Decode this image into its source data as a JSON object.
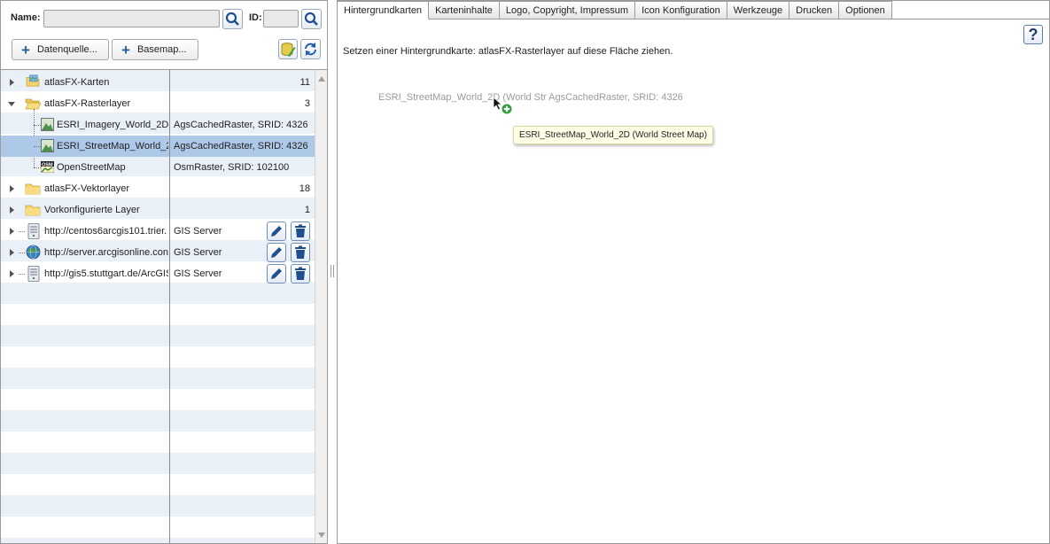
{
  "search": {
    "name_label": "Name:",
    "name_value": "",
    "id_label": "ID:",
    "id_value": ""
  },
  "toolbar": {
    "datasource_label": "Datenquelle...",
    "basemap_label": "Basemap..."
  },
  "tree": {
    "rows": [
      {
        "label": "atlasFX-Karten",
        "count": "11",
        "icon": "map-folder-icon"
      },
      {
        "label": "atlasFX-Rasterlayer",
        "count": "3",
        "icon": "open-folder-icon"
      },
      {
        "label": "ESRI_Imagery_World_2D (",
        "type": "AgsCachedRaster, SRID: 4326",
        "icon": "raster-layer-icon"
      },
      {
        "label": "ESRI_StreetMap_World_2D",
        "type": "AgsCachedRaster, SRID: 4326",
        "icon": "raster-layer-icon"
      },
      {
        "label": "OpenStreetMap",
        "type": "OsmRaster, SRID: 102100",
        "icon": "osm-icon"
      },
      {
        "label": "atlasFX-Vektorlayer",
        "count": "18",
        "icon": "folder-icon"
      },
      {
        "label": "Vorkonfigurierte Layer",
        "count": "1",
        "icon": "folder-icon"
      },
      {
        "label": "http://centos6arcgis101.trier.",
        "type": "GIS Server",
        "icon": "server-icon"
      },
      {
        "label": "http://server.arcgisonline.con",
        "type": "GIS Server",
        "icon": "globe-icon"
      },
      {
        "label": "http://gis5.stuttgart.de/ArcGIS",
        "type": "GIS Server",
        "icon": "server-icon"
      }
    ]
  },
  "tabs": [
    "Hintergrundkarten",
    "Karteninhalte",
    "Logo, Copyright, Impressum",
    "Icon Konfiguration",
    "Werkzeuge",
    "Drucken",
    "Optionen"
  ],
  "content": {
    "help_label": "?",
    "instruction": "Setzen einer Hintergrundkarte: atlasFX-Rasterlayer auf diese Fläche ziehen.",
    "drag_ghost": "ESRI_StreetMap_World_2D (World Str  AgsCachedRaster, SRID: 4326",
    "tooltip": "ESRI_StreetMap_World_2D (World Street Map)"
  },
  "colors": {
    "accent": "#2a5f9e",
    "selection": "#aec8e8",
    "stripe": "#eaf0f8",
    "tooltip_bg": "#ffffe6"
  }
}
